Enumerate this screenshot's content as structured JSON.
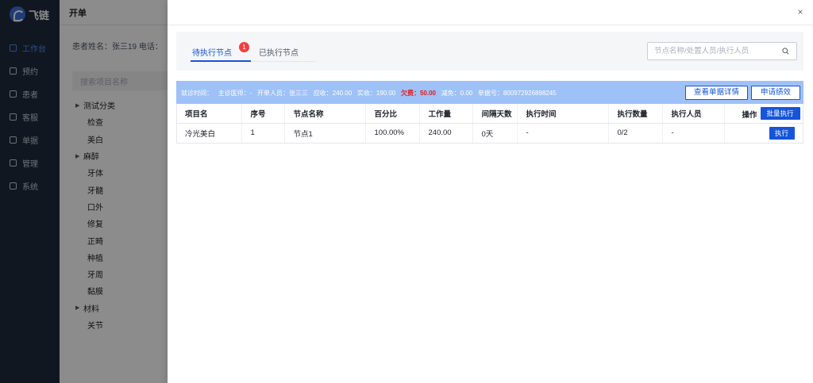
{
  "background": {
    "brand": "飞链",
    "nav": [
      {
        "label": "工作台",
        "active": true
      },
      {
        "label": "预约"
      },
      {
        "label": "患者"
      },
      {
        "label": "客服"
      },
      {
        "label": "单据"
      },
      {
        "label": "管理"
      },
      {
        "label": "系统"
      }
    ],
    "sheet_title": "开单",
    "patient_line": "患者姓名：张三19    电话：",
    "search_placeholder": "搜索项目名称",
    "tree": [
      {
        "label": "测试分类",
        "collapsed": true
      },
      {
        "label": "检查",
        "child": true
      },
      {
        "label": "美白",
        "child": true
      },
      {
        "label": "麻醉",
        "collapsed": true
      },
      {
        "label": "牙体",
        "child": true
      },
      {
        "label": "牙髓",
        "child": true
      },
      {
        "label": "口外",
        "child": true
      },
      {
        "label": "修复",
        "child": true
      },
      {
        "label": "正畸",
        "child": true
      },
      {
        "label": "种植",
        "child": true
      },
      {
        "label": "牙周",
        "child": true
      },
      {
        "label": "黏膜",
        "child": true
      },
      {
        "label": "材料",
        "collapsed": true
      },
      {
        "label": "关节",
        "child": true
      }
    ]
  },
  "drawer": {
    "close_label": "×",
    "tabs": [
      {
        "label": "待执行节点",
        "badge": "1",
        "active": true
      },
      {
        "label": "已执行节点"
      }
    ],
    "search_placeholder": "节点名称/处置人员/执行人员",
    "info": {
      "visit_time": "就诊时间：",
      "doctor": "主诊医师：-",
      "creator": "开单人员：张三三",
      "receivable": "应收：240.00",
      "received": "实收：190.00",
      "owed": "欠费：50.00",
      "discount": "减免：0.00",
      "order_no": "单据号：800972926898245"
    },
    "buttons": {
      "detail": "查看单据详情",
      "performance": "申请绩效",
      "batch_execute": "批量执行",
      "execute": "执行"
    },
    "columns": [
      "项目名",
      "序号",
      "节点名称",
      "百分比",
      "工作量",
      "间隔天数",
      "执行时间",
      "执行数量",
      "执行人员",
      "操作"
    ],
    "rows": [
      [
        "冷光美白",
        "1",
        "节点1",
        "100.00%",
        "240.00",
        "0天",
        "-",
        "0/2",
        "-"
      ]
    ]
  },
  "colors": {
    "primary": "#1654d9",
    "info_bar": "#9ec1f7",
    "danger": "#f53f3f"
  }
}
